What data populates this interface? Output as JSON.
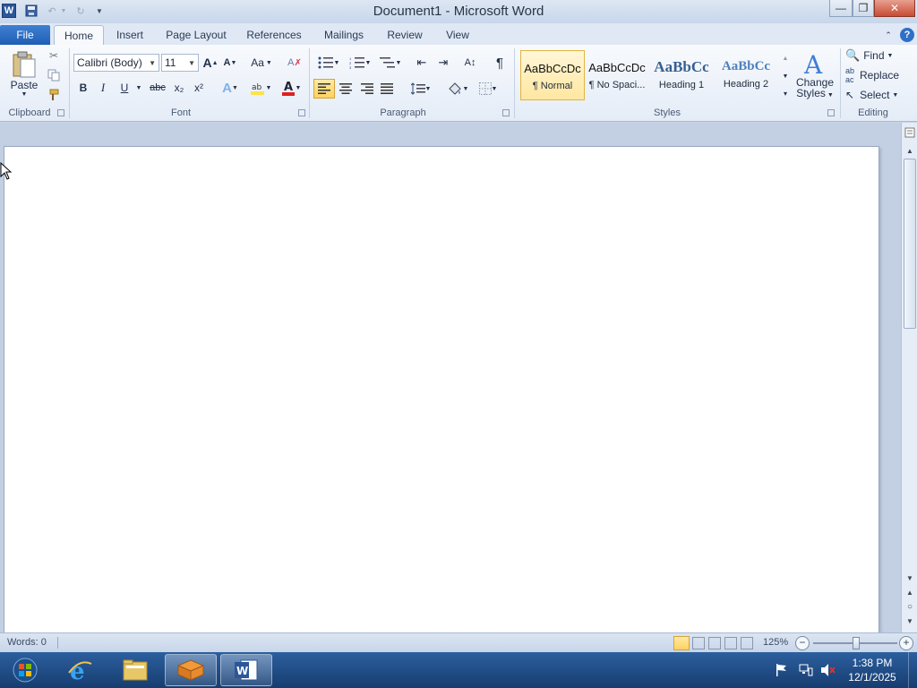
{
  "window": {
    "title": "Document1 - Microsoft Word"
  },
  "quick_access": {
    "save_icon": "save-icon",
    "undo_icon": "undo-icon",
    "redo_icon": "repeat-icon",
    "customize_icon": "customize-qat-icon"
  },
  "tabs": [
    {
      "label": "File"
    },
    {
      "label": "Home"
    },
    {
      "label": "Insert"
    },
    {
      "label": "Page Layout"
    },
    {
      "label": "References"
    },
    {
      "label": "Mailings"
    },
    {
      "label": "Review"
    },
    {
      "label": "View"
    }
  ],
  "ribbon": {
    "clipboard": {
      "label": "Clipboard",
      "paste_label": "Paste"
    },
    "font": {
      "label": "Font",
      "font_name": "Calibri (Body)",
      "font_size": "11",
      "case_label": "Aa",
      "bold": "B",
      "italic": "I",
      "underline": "U",
      "strike": "abc",
      "sub": "x₂",
      "sup": "x²"
    },
    "paragraph": {
      "label": "Paragraph",
      "pilcrow": "¶"
    },
    "styles": {
      "label": "Styles",
      "items": [
        {
          "sample": "AaBbCcDc",
          "name": "¶ Normal"
        },
        {
          "sample": "AaBbCcDc",
          "name": "¶ No Spaci..."
        },
        {
          "sample": "AaBbCc",
          "name": "Heading 1"
        },
        {
          "sample": "AaBbCc",
          "name": "Heading 2"
        }
      ],
      "change_styles_line1": "Change",
      "change_styles_line2": "Styles"
    },
    "editing": {
      "label": "Editing",
      "find": "Find",
      "replace": "Replace",
      "select": "Select"
    }
  },
  "status": {
    "words": "Words: 0",
    "zoom": "125%"
  },
  "taskbar": {
    "time": "1:38 PM",
    "date": "12/1/2025"
  },
  "colors": {
    "file_tab": "#1f5fb5",
    "taskbar": "#1f4f8a",
    "close_button": "#c84b33",
    "highlight": "#ffe24a",
    "font_color": "#e02020"
  }
}
